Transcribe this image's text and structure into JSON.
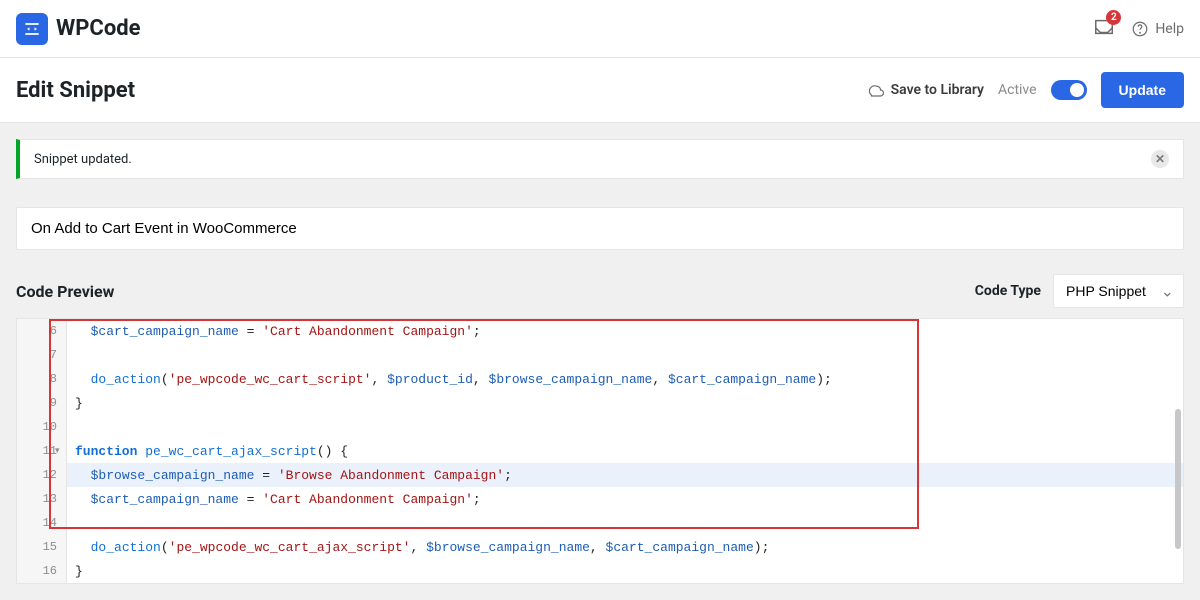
{
  "topbar": {
    "brand": "WPCode",
    "notifications_count": "2",
    "help_label": "Help"
  },
  "header": {
    "page_title": "Edit Snippet",
    "save_to_library": "Save to Library",
    "active_label": "Active",
    "update_btn": "Update"
  },
  "notice": {
    "text": "Snippet updated."
  },
  "snippet": {
    "title_value": "On Add to Cart Event in WooCommerce"
  },
  "preview": {
    "label": "Code Preview",
    "code_type_label": "Code Type",
    "code_type_value": "PHP Snippet"
  },
  "code_lines": [
    {
      "n": "6"
    },
    {
      "n": "7"
    },
    {
      "n": "8"
    },
    {
      "n": "9"
    },
    {
      "n": "10"
    },
    {
      "n": "11"
    },
    {
      "n": "12"
    },
    {
      "n": "13"
    },
    {
      "n": "14"
    },
    {
      "n": "15"
    },
    {
      "n": "16"
    }
  ],
  "code_tokens": {
    "l6": {
      "indent": "  ",
      "var": "$cart_campaign_name",
      "eq": " = ",
      "str": "'Cart Abandonment Campaign'",
      "end": ";"
    },
    "l8": {
      "indent": "  ",
      "fn": "do_action",
      "open": "(",
      "str": "'pe_wpcode_wc_cart_script'",
      "c1": ", ",
      "v1": "$product_id",
      "c2": ", ",
      "v2": "$browse_campaign_name",
      "c3": ", ",
      "v3": "$cart_campaign_name",
      "close": ");"
    },
    "l9": {
      "brace": "}"
    },
    "l11": {
      "kw": "function",
      "sp": " ",
      "fn": "pe_wc_cart_ajax_script",
      "paren": "()",
      "sp2": " ",
      "brace": "{"
    },
    "l12": {
      "indent": "  ",
      "var": "$browse_campaign_name",
      "eq": " = ",
      "str": "'Browse Abandonment Campaign'",
      "end": ";"
    },
    "l13": {
      "indent": "  ",
      "var": "$cart_campaign_name",
      "eq": " = ",
      "str": "'Cart Abandonment Campaign'",
      "end": ";"
    },
    "l15": {
      "indent": "  ",
      "fn": "do_action",
      "open": "(",
      "str": "'pe_wpcode_wc_cart_ajax_script'",
      "c1": ", ",
      "v1": "$browse_campaign_name",
      "c2": ", ",
      "v2": "$cart_campaign_name",
      "close": ");"
    },
    "l16": {
      "brace": "}"
    }
  }
}
